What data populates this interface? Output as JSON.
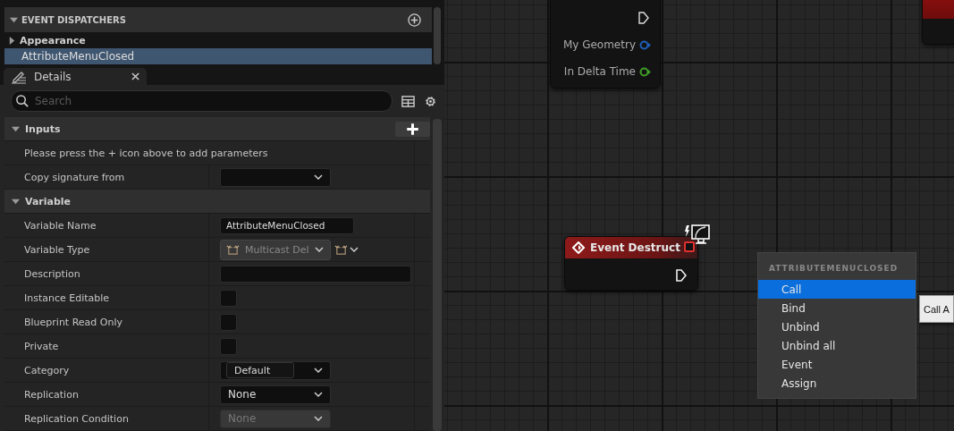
{
  "dispatchers": {
    "title": "EVENT DISPATCHERS",
    "categories": [
      {
        "label": "Appearance",
        "expanded": false
      }
    ],
    "items": [
      {
        "label": "AttributeMenuClosed",
        "selected": true
      }
    ]
  },
  "details_tab": {
    "title": "Details"
  },
  "search": {
    "placeholder": "Search"
  },
  "sections": [
    {
      "title": "Inputs",
      "expanded": true,
      "rows": [
        {
          "kind": "note",
          "label": "Please press the + icon above to add parameters"
        },
        {
          "kind": "dropdown",
          "label": "Copy signature from"
        }
      ]
    },
    {
      "title": "Variable",
      "expanded": true,
      "rows": [
        {
          "kind": "text",
          "label": "Variable Name",
          "value": "AttributeMenuClosed"
        },
        {
          "kind": "type",
          "label": "Variable Type",
          "value": "Multicast Del"
        },
        {
          "kind": "longtext",
          "label": "Description"
        },
        {
          "kind": "checkbox",
          "label": "Instance Editable",
          "checked": false
        },
        {
          "kind": "checkbox",
          "label": "Blueprint Read Only",
          "checked": false
        },
        {
          "kind": "checkbox",
          "label": "Private",
          "checked": false
        },
        {
          "kind": "combo",
          "label": "Category",
          "value": "Default"
        },
        {
          "kind": "dropdown",
          "label": "Replication",
          "value": "None"
        },
        {
          "kind": "dropdown",
          "label": "Replication Condition",
          "value": "None",
          "disabled": true
        }
      ]
    }
  ],
  "graph": {
    "tick_node": {
      "pins": [
        {
          "label": "My Geometry",
          "color": "#1f5fb8"
        },
        {
          "label": "In Delta Time",
          "color": "#3ea028"
        }
      ]
    },
    "event_node": {
      "title": "Event Destruct"
    },
    "context_menu": {
      "title": "ATTRIBUTEMENUCLOSED",
      "items": [
        {
          "label": "Call",
          "selected": true
        },
        {
          "label": "Bind",
          "selected": false
        },
        {
          "label": "Unbind",
          "selected": false
        },
        {
          "label": "Unbind all",
          "selected": false
        },
        {
          "label": "Event",
          "selected": false
        },
        {
          "label": "Assign",
          "selected": false
        }
      ]
    },
    "tooltip": {
      "text": "Call A"
    }
  }
}
